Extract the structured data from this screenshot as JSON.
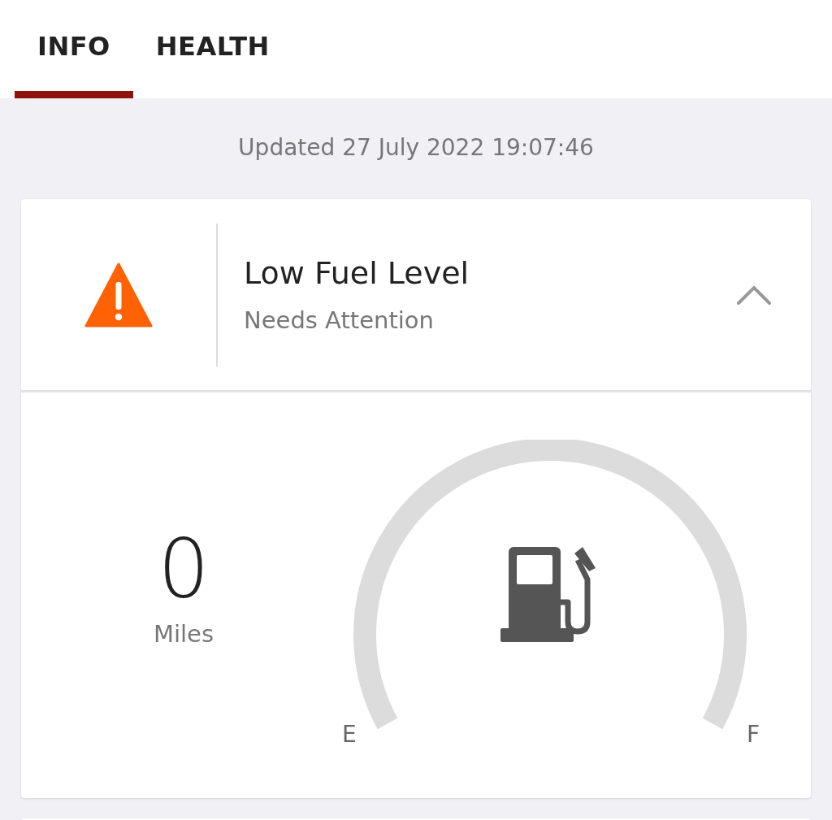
{
  "tabs": [
    {
      "label": "INFO",
      "selected": true
    },
    {
      "label": "HEALTH",
      "selected": false
    }
  ],
  "updated": "Updated 27 July 2022 19:07:46",
  "alert": {
    "title": "Low Fuel Level",
    "subtitle": "Needs Attention",
    "expanded": true
  },
  "fuel": {
    "range": "0",
    "unit": "Miles",
    "gauge": {
      "empty_label": "E",
      "full_label": "F"
    }
  }
}
